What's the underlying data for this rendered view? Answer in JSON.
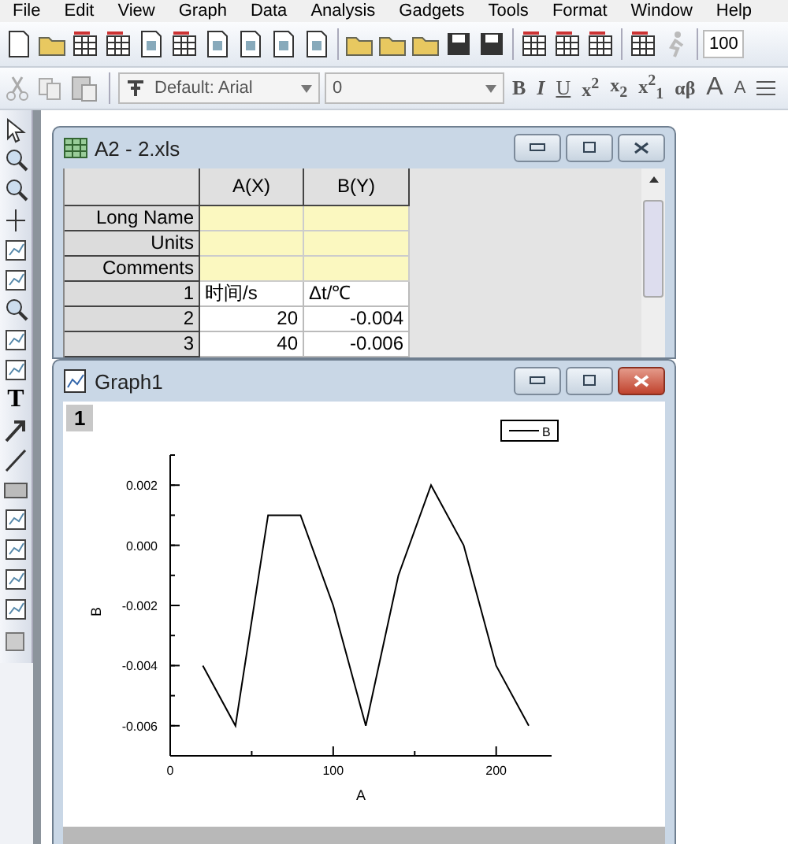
{
  "menu": [
    "File",
    "Edit",
    "View",
    "Graph",
    "Data",
    "Analysis",
    "Gadgets",
    "Tools",
    "Format",
    "Window",
    "Help"
  ],
  "toolbar": {
    "zoom": "100"
  },
  "format_toolbar": {
    "font": "Default: Arial",
    "size": "0",
    "buttons": [
      {
        "label": "B",
        "kind": "bold"
      },
      {
        "label": "I",
        "kind": "italic"
      },
      {
        "label": "U",
        "kind": "underline"
      },
      {
        "label": "x$^{2}$",
        "kind": "script"
      },
      {
        "label": "x$_{2}$",
        "kind": "script"
      },
      {
        "label": "x$^{2}$$_{1}$",
        "kind": "script"
      },
      {
        "label": "αβ",
        "kind": "script"
      },
      {
        "label": "A",
        "kind": "grow"
      },
      {
        "label": "A",
        "kind": "shrink"
      }
    ]
  },
  "tools": {
    "text_tool": "T"
  },
  "workbook": {
    "title": "A2 - 2.xls",
    "columns": [
      "A(X)",
      "B(Y)"
    ],
    "label_rows": [
      "Long Name",
      "Units",
      "Comments"
    ],
    "rows": [
      {
        "index": "1",
        "cells": [
          "时间/s",
          "Δt/℃"
        ]
      },
      {
        "index": "2",
        "cells": [
          "20",
          "-0.004"
        ]
      },
      {
        "index": "3",
        "cells": [
          "40",
          "-0.006"
        ]
      }
    ]
  },
  "graph": {
    "title": "Graph1",
    "layer": "1",
    "chart_data": {
      "type": "line",
      "xlabel": "A",
      "ylabel": "B",
      "x": [
        20,
        40,
        60,
        80,
        100,
        120,
        140,
        160,
        180,
        200,
        220
      ],
      "series": [
        {
          "name": "B",
          "color": "#000000",
          "values": [
            -0.004,
            -0.006,
            0.001,
            0.001,
            -0.002,
            -0.006,
            -0.001,
            0.002,
            0.0,
            -0.004,
            -0.006
          ]
        }
      ],
      "xlim": [
        0,
        234
      ],
      "ylim": [
        -0.007,
        0.003
      ],
      "xticks": [
        0,
        100,
        200
      ],
      "yticks": [
        {
          "value": -0.006,
          "label": "-0.006"
        },
        {
          "value": -0.004,
          "label": "-0.004"
        },
        {
          "value": -0.002,
          "label": "-0.002"
        },
        {
          "value": 0,
          "label": "0.000"
        },
        {
          "value": 0.002,
          "label": "0.002"
        }
      ]
    }
  }
}
